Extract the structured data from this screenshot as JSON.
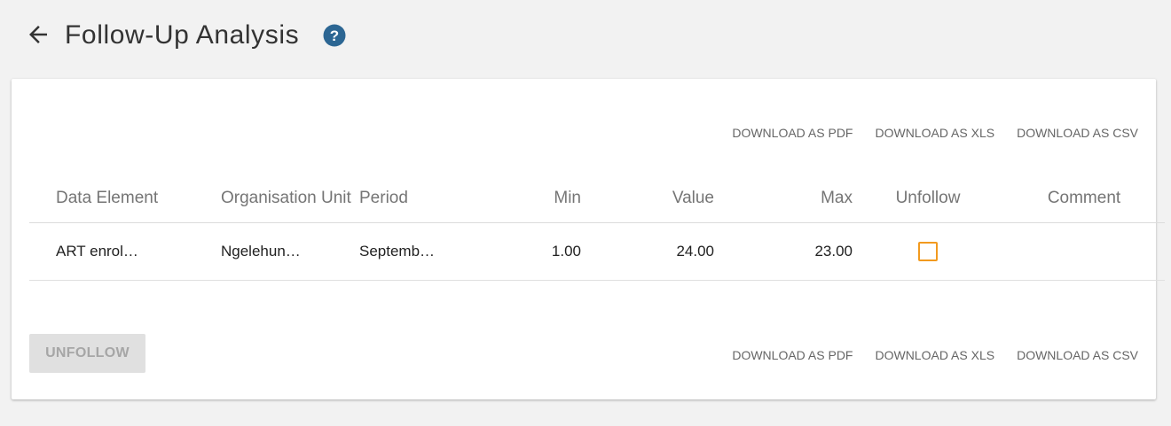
{
  "header": {
    "title": "Follow-Up Analysis"
  },
  "downloads": {
    "pdf": "DOWNLOAD AS PDF",
    "xls": "DOWNLOAD AS XLS",
    "csv": "DOWNLOAD AS CSV"
  },
  "table": {
    "columns": [
      "Data Element",
      "Organisation Unit",
      "Period",
      "Min",
      "Value",
      "Max",
      "Unfollow",
      "Comment"
    ],
    "rows": [
      {
        "data_element": "ART enroll…",
        "org_unit": "Ngelehun …",
        "period": "Septembe…",
        "min": "1.00",
        "value": "24.00",
        "max": "23.00",
        "unfollow_checked": false,
        "comment": ""
      }
    ]
  },
  "actions": {
    "unfollow_label": "UNFOLLOW"
  },
  "colors": {
    "background": "#f2f2f2",
    "help_icon": "#2c6693",
    "checkbox_border": "#f29a1f",
    "disabled_button": "#e0e0e0"
  }
}
